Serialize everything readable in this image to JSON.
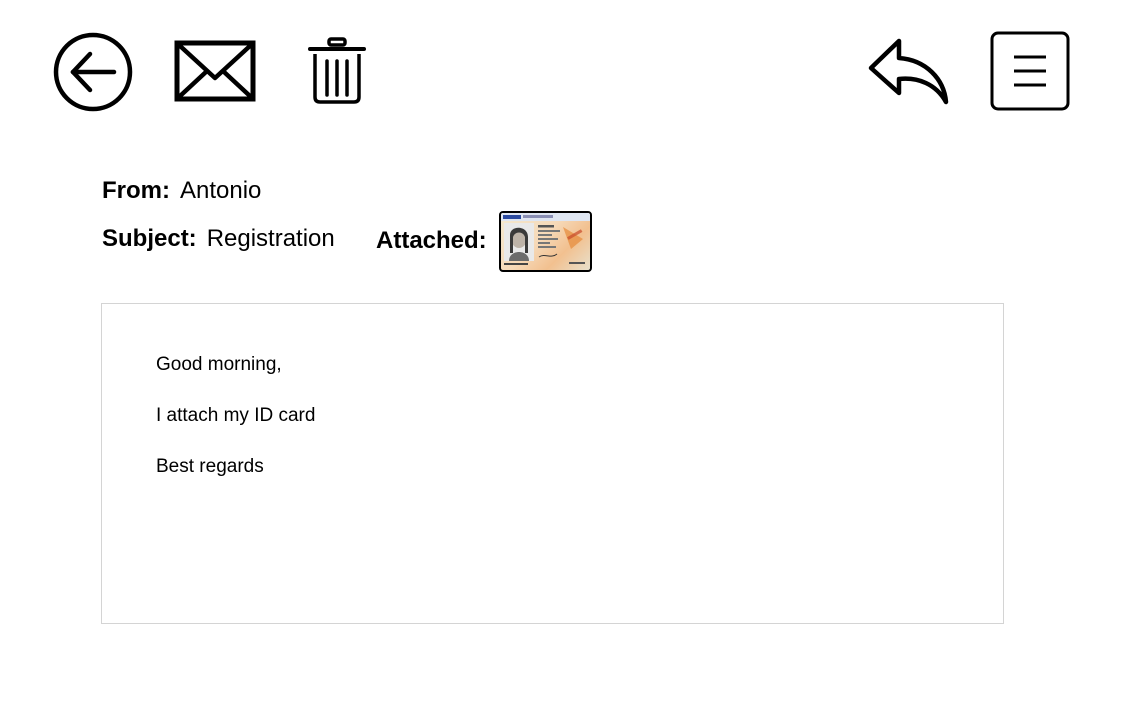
{
  "toolbar": {
    "icons": {
      "back": "back-arrow-circle-icon",
      "mail": "envelope-icon",
      "trash": "trash-can-icon",
      "reply": "reply-arrow-icon",
      "menu": "hamburger-menu-icon"
    }
  },
  "header": {
    "from_label": "From:",
    "from_value": "Antonio",
    "subject_label": "Subject:",
    "subject_value": "Registration",
    "attached_label": "Attached:",
    "attachment_icon": "id-card-thumbnail"
  },
  "body": {
    "lines": [
      "Good morning,",
      "I attach my ID card",
      "Best regards"
    ]
  },
  "colors": {
    "text": "#000000",
    "border": "#d4d4d4",
    "background": "#ffffff"
  }
}
